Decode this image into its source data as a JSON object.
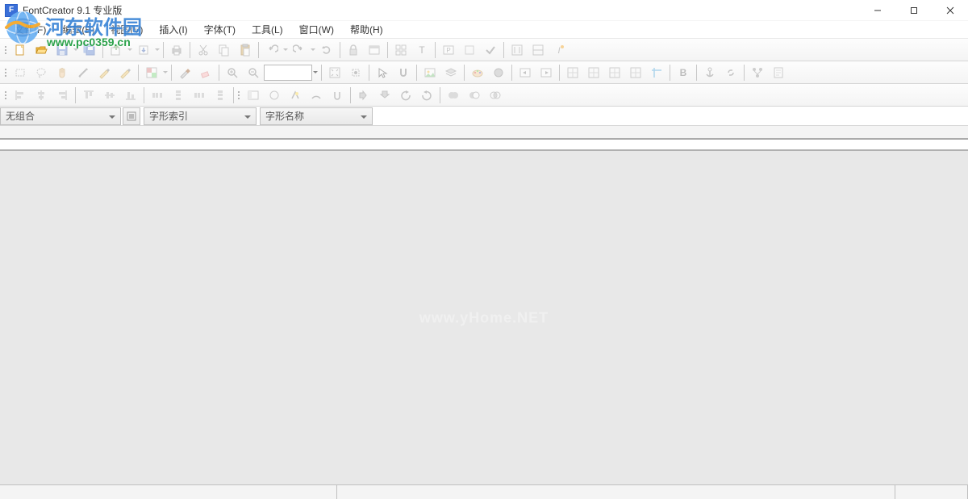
{
  "title": "FontCreator 9.1 专业版",
  "menu": [
    "文件(F)",
    "编辑(E)",
    "视图(V)",
    "插入(I)",
    "字体(T)",
    "工具(L)",
    "窗口(W)",
    "帮助(H)"
  ],
  "combos": {
    "group": "无组合",
    "index": "字形索引",
    "name": "字形名称"
  },
  "watermark": {
    "brand": "河东软件园",
    "url": "www.pc0359.cn",
    "center": "www.yHome.NET"
  },
  "toolbar1": [
    {
      "name": "new-file-icon",
      "type": "new",
      "enabled": true
    },
    {
      "name": "open-file-icon",
      "type": "open",
      "enabled": true
    },
    {
      "name": "save-icon",
      "type": "save",
      "enabled": false,
      "split": true
    },
    {
      "name": "save-all-icon",
      "type": "saveall",
      "enabled": false
    },
    {
      "sep": true
    },
    {
      "name": "export-icon",
      "type": "export",
      "enabled": false,
      "split": true
    },
    {
      "name": "install-icon",
      "type": "install",
      "enabled": false,
      "split": true
    },
    {
      "sep": true
    },
    {
      "name": "print-icon",
      "type": "print",
      "enabled": false
    },
    {
      "sep": true
    },
    {
      "name": "cut-icon",
      "type": "cut",
      "enabled": false
    },
    {
      "name": "copy-icon",
      "type": "copy",
      "enabled": false
    },
    {
      "name": "paste-icon",
      "type": "paste",
      "enabled": false
    },
    {
      "sep": true
    },
    {
      "name": "undo-icon",
      "type": "undo",
      "enabled": false,
      "split": true
    },
    {
      "name": "redo-icon",
      "type": "redo",
      "enabled": false,
      "split": true
    },
    {
      "name": "repeat-icon",
      "type": "repeat",
      "enabled": false
    },
    {
      "sep": true
    },
    {
      "name": "lock-icon",
      "type": "lock",
      "enabled": false
    },
    {
      "name": "window-icon",
      "type": "window",
      "enabled": false
    },
    {
      "sep": true
    },
    {
      "name": "categories-icon",
      "type": "grid",
      "enabled": false
    },
    {
      "name": "text-tool-icon",
      "type": "text",
      "enabled": false
    },
    {
      "sep": true
    },
    {
      "name": "preview-icon",
      "type": "preview",
      "enabled": false
    },
    {
      "name": "refresh-icon",
      "type": "refresh",
      "enabled": false
    },
    {
      "name": "validate-icon",
      "type": "check",
      "enabled": false
    },
    {
      "sep": true
    },
    {
      "name": "autokern-icon",
      "type": "kern",
      "enabled": false
    },
    {
      "name": "autometrics-icon",
      "type": "metrics",
      "enabled": false
    },
    {
      "name": "autohint-icon",
      "type": "hint",
      "enabled": false
    }
  ],
  "toolbar2": [
    {
      "name": "select-rect-icon",
      "type": "rect",
      "enabled": false
    },
    {
      "name": "lasso-icon",
      "type": "lasso",
      "enabled": false
    },
    {
      "name": "hand-icon",
      "type": "hand",
      "enabled": false
    },
    {
      "name": "measure-icon",
      "type": "measure",
      "enabled": false
    },
    {
      "name": "pen-icon",
      "type": "pen",
      "enabled": false
    },
    {
      "name": "freehand-icon",
      "type": "free",
      "enabled": false
    },
    {
      "sep": true
    },
    {
      "name": "color-picker-icon",
      "type": "color",
      "enabled": false,
      "split": true
    },
    {
      "sep": true
    },
    {
      "name": "knife-icon",
      "type": "knife",
      "enabled": false
    },
    {
      "name": "eraser-icon",
      "type": "eraser",
      "enabled": false
    },
    {
      "sep": true
    },
    {
      "name": "zoom-in-icon",
      "type": "zoomin",
      "enabled": false
    },
    {
      "name": "zoom-out-icon",
      "type": "zoomout",
      "enabled": false
    },
    {
      "combo": true,
      "name": "zoom-combo"
    },
    {
      "sep": true
    },
    {
      "name": "fit-window-icon",
      "type": "fit",
      "enabled": false
    },
    {
      "name": "fit-selection-icon",
      "type": "fitsel",
      "enabled": false
    },
    {
      "sep": true
    },
    {
      "name": "pointer-icon",
      "type": "pointer",
      "enabled": false
    },
    {
      "name": "snap-icon",
      "type": "snap",
      "enabled": false
    },
    {
      "sep": true
    },
    {
      "name": "image-icon",
      "type": "image",
      "enabled": false
    },
    {
      "name": "layers-icon",
      "type": "layers",
      "enabled": false
    },
    {
      "sep": true
    },
    {
      "name": "paint-icon",
      "type": "paint",
      "enabled": false
    },
    {
      "name": "circle-icon",
      "type": "circle",
      "enabled": false
    },
    {
      "sep": true
    },
    {
      "name": "nav-left-icon",
      "type": "navleft",
      "enabled": false
    },
    {
      "name": "nav-right-icon",
      "type": "navright",
      "enabled": false
    },
    {
      "sep": true
    },
    {
      "name": "grid-1-icon",
      "type": "g1",
      "enabled": false
    },
    {
      "name": "grid-2-icon",
      "type": "g2",
      "enabled": false
    },
    {
      "name": "grid-3-icon",
      "type": "g3",
      "enabled": false
    },
    {
      "name": "grid-4-icon",
      "type": "g4",
      "enabled": false
    },
    {
      "name": "guides-icon",
      "type": "guides",
      "enabled": false
    },
    {
      "sep": true
    },
    {
      "name": "bold-icon",
      "type": "bold",
      "enabled": false
    },
    {
      "sep": true
    },
    {
      "name": "anchor-icon",
      "type": "anchor",
      "enabled": false
    },
    {
      "name": "link-icon",
      "type": "link",
      "enabled": false
    },
    {
      "sep": true
    },
    {
      "name": "tree-icon",
      "type": "tree",
      "enabled": false
    },
    {
      "name": "script-icon",
      "type": "script",
      "enabled": false
    }
  ],
  "toolbar3": [
    {
      "name": "align-left-icon",
      "type": "al",
      "enabled": false
    },
    {
      "name": "align-center-icon",
      "type": "ac",
      "enabled": false
    },
    {
      "name": "align-right-icon",
      "type": "ar",
      "enabled": false
    },
    {
      "sep": true
    },
    {
      "name": "align-top-icon",
      "type": "at",
      "enabled": false
    },
    {
      "name": "align-middle-icon",
      "type": "am",
      "enabled": false
    },
    {
      "name": "align-bottom-icon",
      "type": "ab",
      "enabled": false
    },
    {
      "sep": true
    },
    {
      "name": "dist-h-icon",
      "type": "dh",
      "enabled": false
    },
    {
      "name": "dist-v-icon",
      "type": "dv",
      "enabled": false
    },
    {
      "name": "space-h-icon",
      "type": "sh",
      "enabled": false
    },
    {
      "name": "space-v-icon",
      "type": "sv",
      "enabled": false
    },
    {
      "sep": true
    },
    {
      "grip": true
    },
    {
      "name": "panel-1-icon",
      "type": "p1",
      "enabled": false
    },
    {
      "name": "panel-2-icon",
      "type": "p2",
      "enabled": false
    },
    {
      "name": "highlight-icon",
      "type": "hl",
      "enabled": false
    },
    {
      "name": "arc-icon",
      "type": "arc",
      "enabled": false
    },
    {
      "name": "horseshoe-icon",
      "type": "hs",
      "enabled": false
    },
    {
      "sep": true
    },
    {
      "name": "flip-h-icon",
      "type": "fh",
      "enabled": false
    },
    {
      "name": "flip-v-icon",
      "type": "fv",
      "enabled": false
    },
    {
      "name": "rotate-left-icon",
      "type": "rl",
      "enabled": false
    },
    {
      "name": "rotate-right-icon",
      "type": "rr",
      "enabled": false
    },
    {
      "sep": true
    },
    {
      "name": "union-icon",
      "type": "un",
      "enabled": false
    },
    {
      "name": "subtract-icon",
      "type": "sub",
      "enabled": false
    },
    {
      "name": "intersect-icon",
      "type": "int",
      "enabled": false
    }
  ]
}
